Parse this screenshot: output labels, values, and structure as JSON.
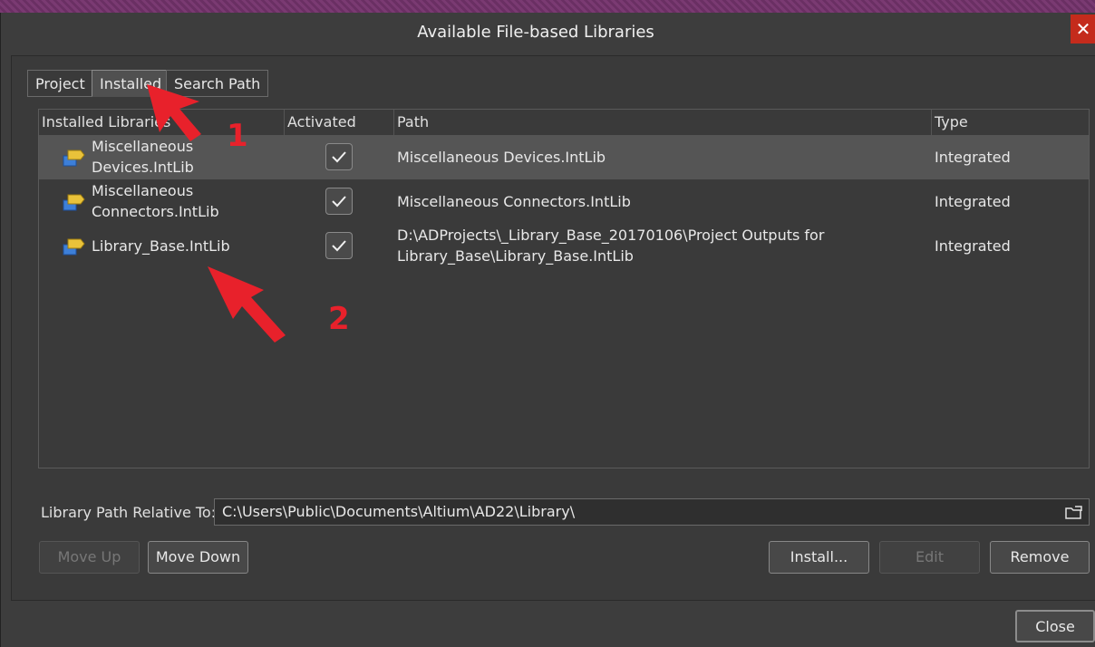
{
  "dialog": {
    "title": "Available File-based Libraries",
    "close_glyph": "✕"
  },
  "tabs": [
    {
      "label": "Project",
      "active": false
    },
    {
      "label": "Installed",
      "active": true
    },
    {
      "label": "Search Path",
      "active": false
    }
  ],
  "grid": {
    "columns": [
      "Installed Libraries",
      "Activated",
      "Path",
      "Type"
    ],
    "rows": [
      {
        "name_line1": "Miscellaneous",
        "name_line2": "Devices.IntLib",
        "activated": true,
        "path_line1": "Miscellaneous Devices.IntLib",
        "path_line2": "",
        "type": "Integrated",
        "selected": true
      },
      {
        "name_line1": "Miscellaneous",
        "name_line2": "Connectors.IntLib",
        "activated": true,
        "path_line1": "Miscellaneous Connectors.IntLib",
        "path_line2": "",
        "type": "Integrated",
        "selected": false
      },
      {
        "name_line1": "Library_Base.IntLib",
        "name_line2": "",
        "activated": true,
        "path_line1": "D:\\ADProjects\\_Library_Base_20170106\\Project Outputs for",
        "path_line2": "Library_Base\\Library_Base.IntLib",
        "type": "Integrated",
        "selected": false
      }
    ]
  },
  "relative": {
    "label": "Library Path Relative To:",
    "value": "C:\\Users\\Public\\Documents\\Altium\\AD22\\Library\\"
  },
  "buttons": {
    "move_up": "Move Up",
    "move_down": "Move Down",
    "install": "Install...",
    "edit": "Edit",
    "remove": "Remove",
    "close": "Close"
  },
  "annotations": [
    "1",
    "2"
  ],
  "colors": {
    "accent_red": "#e8212b",
    "selected_row": "#555555",
    "close_red": "#c42b1c"
  },
  "icons": {
    "library": "library-icon",
    "checkbox": "check-icon",
    "folder": "folder-open-icon"
  }
}
